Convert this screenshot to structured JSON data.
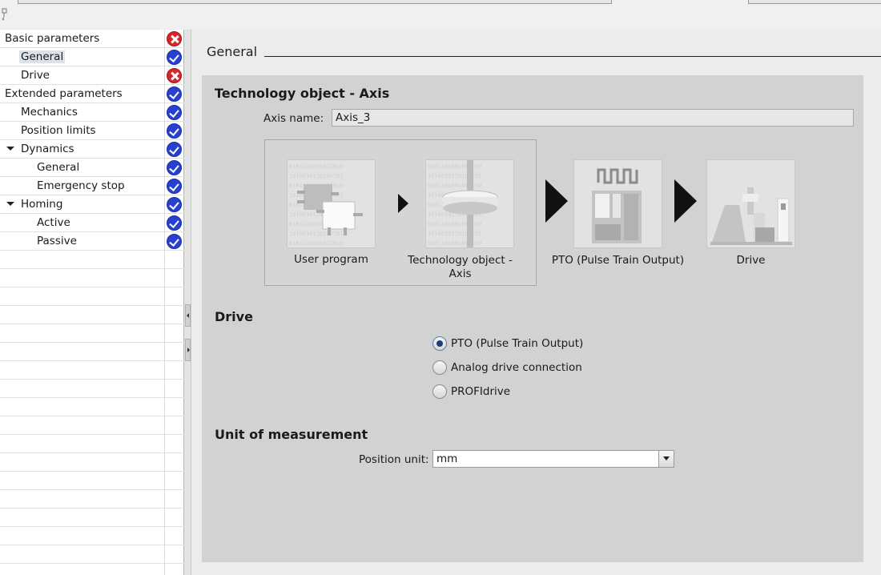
{
  "tree": {
    "items": [
      {
        "label": "Basic parameters",
        "status": "error",
        "level": 0,
        "expander": false,
        "selected": false
      },
      {
        "label": "General",
        "status": "ok",
        "level": 1,
        "expander": false,
        "selected": true
      },
      {
        "label": "Drive",
        "status": "error",
        "level": 1,
        "expander": false,
        "selected": false
      },
      {
        "label": "Extended parameters",
        "status": "ok",
        "level": 0,
        "expander": false,
        "selected": false
      },
      {
        "label": "Mechanics",
        "status": "ok",
        "level": 1,
        "expander": false,
        "selected": false
      },
      {
        "label": "Position limits",
        "status": "ok",
        "level": 1,
        "expander": false,
        "selected": false
      },
      {
        "label": "Dynamics",
        "status": "ok",
        "level": 1,
        "expander": true,
        "selected": false
      },
      {
        "label": "General",
        "status": "ok",
        "level": 2,
        "expander": false,
        "selected": false
      },
      {
        "label": "Emergency stop",
        "status": "ok",
        "level": 2,
        "expander": false,
        "selected": false
      },
      {
        "label": "Homing",
        "status": "ok",
        "level": 1,
        "expander": true,
        "selected": false
      },
      {
        "label": "Active",
        "status": "ok",
        "level": 2,
        "expander": false,
        "selected": false
      },
      {
        "label": "Passive",
        "status": "ok",
        "level": 2,
        "expander": false,
        "selected": false
      }
    ]
  },
  "main": {
    "section_title": "General",
    "tech_object": {
      "title": "Technology object - Axis",
      "axis_name_label": "Axis name:",
      "axis_name_value": "Axis_3"
    },
    "flow": {
      "user_program": "User program",
      "tech_object_line1": "Technology object -",
      "tech_object_line2": "Axis",
      "pto": "PTO (Pulse Train Output)",
      "drive": "Drive"
    },
    "drive": {
      "title": "Drive",
      "options": [
        {
          "label": "PTO (Pulse Train Output)",
          "checked": true
        },
        {
          "label": "Analog drive connection",
          "checked": false
        },
        {
          "label": "PROFIdrive",
          "checked": false
        }
      ]
    },
    "unit": {
      "title": "Unit of measurement",
      "position_unit_label": "Position unit:",
      "position_unit_value": "mm"
    }
  },
  "colors": {
    "ok_status": "#2740cf",
    "error_status": "#d4262b",
    "panel_bg": "#d2d2d2",
    "radio_checked": "#1e3d7a"
  }
}
